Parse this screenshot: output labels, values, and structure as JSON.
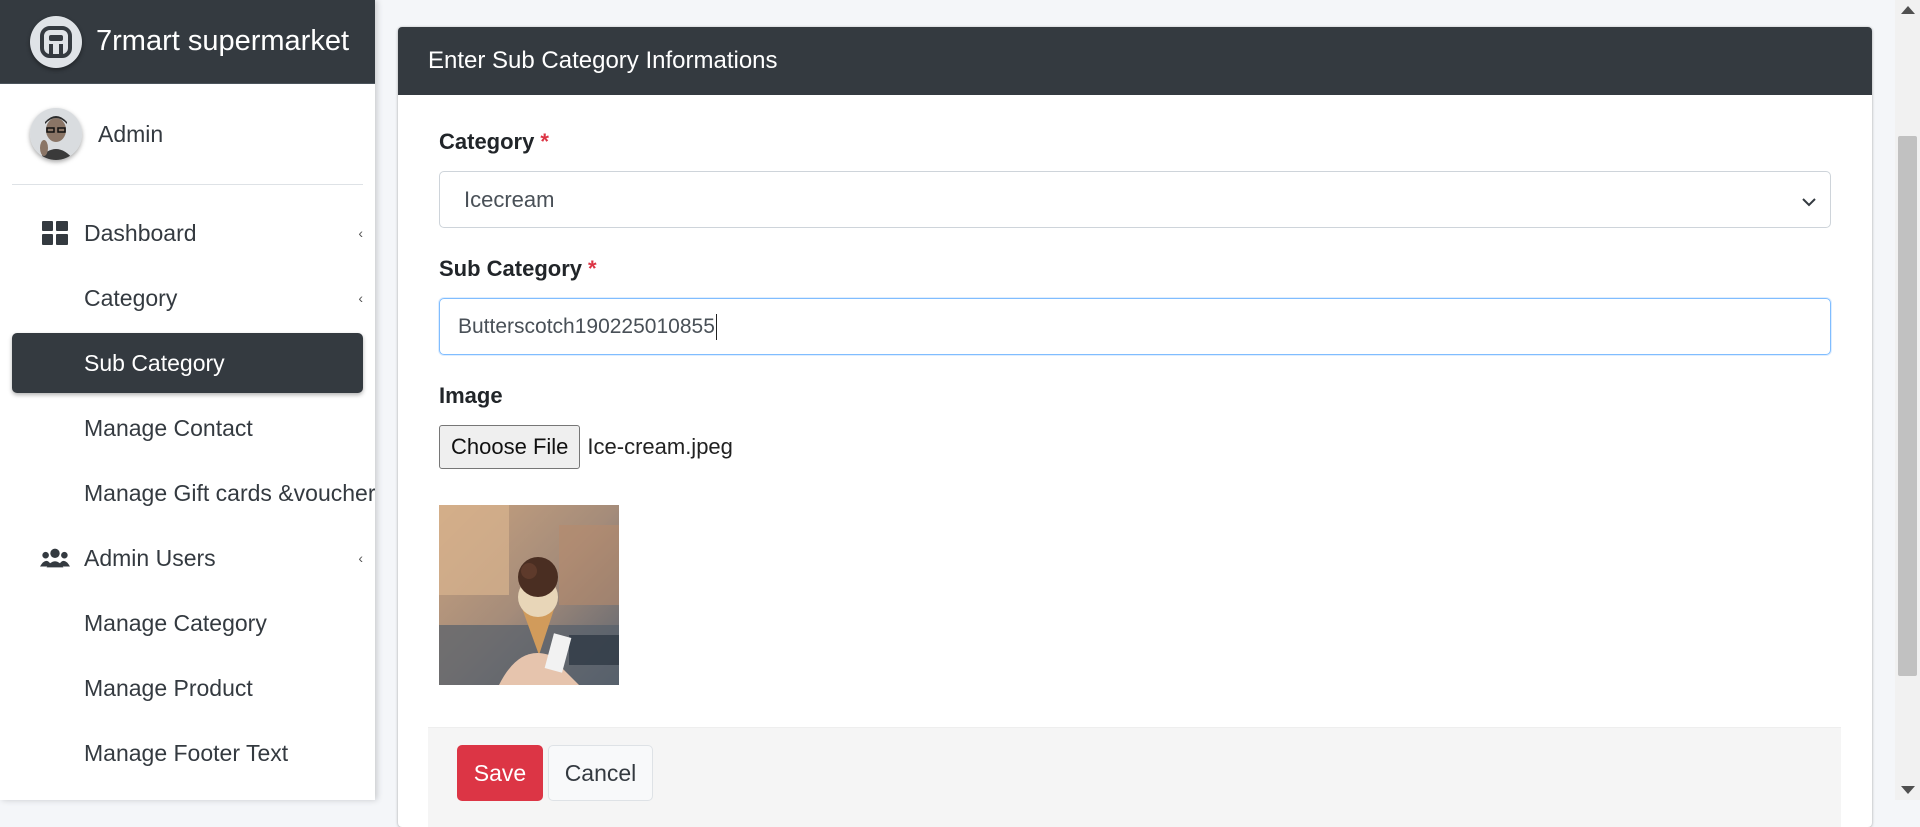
{
  "brand": {
    "name": "7rmart supermarket",
    "logo_icon": "app-logo-icon"
  },
  "user": {
    "name": "Admin",
    "avatar_icon": "user-avatar"
  },
  "sidebar": {
    "items": [
      {
        "label": "Dashboard",
        "icon": "grid-icon",
        "has_caret": true,
        "active": false
      },
      {
        "label": "Category",
        "icon": "",
        "has_caret": true,
        "active": false
      },
      {
        "label": "Sub Category",
        "icon": "",
        "has_caret": false,
        "active": true
      },
      {
        "label": "Manage Contact",
        "icon": "",
        "has_caret": false,
        "active": false
      },
      {
        "label": "Manage Gift cards &voucher",
        "icon": "",
        "has_caret": false,
        "active": false
      },
      {
        "label": "Admin Users",
        "icon": "users-icon",
        "has_caret": true,
        "active": false
      },
      {
        "label": "Manage Category",
        "icon": "",
        "has_caret": false,
        "active": false
      },
      {
        "label": "Manage Product",
        "icon": "",
        "has_caret": false,
        "active": false
      },
      {
        "label": "Manage Footer Text",
        "icon": "",
        "has_caret": false,
        "active": false
      }
    ]
  },
  "form": {
    "header": "Enter Sub Category Informations",
    "category_label": "Category",
    "required_mark": "*",
    "category_value": "Icecream",
    "subcategory_label": "Sub Category",
    "subcategory_value": "Butterscotch190225010855",
    "image_label": "Image",
    "choose_file_label": "Choose File",
    "file_name": "Ice-cream.jpeg",
    "save_label": "Save",
    "cancel_label": "Cancel"
  },
  "colors": {
    "dark": "#343a40",
    "danger": "#dc3545",
    "focus_border": "#80bdff"
  }
}
